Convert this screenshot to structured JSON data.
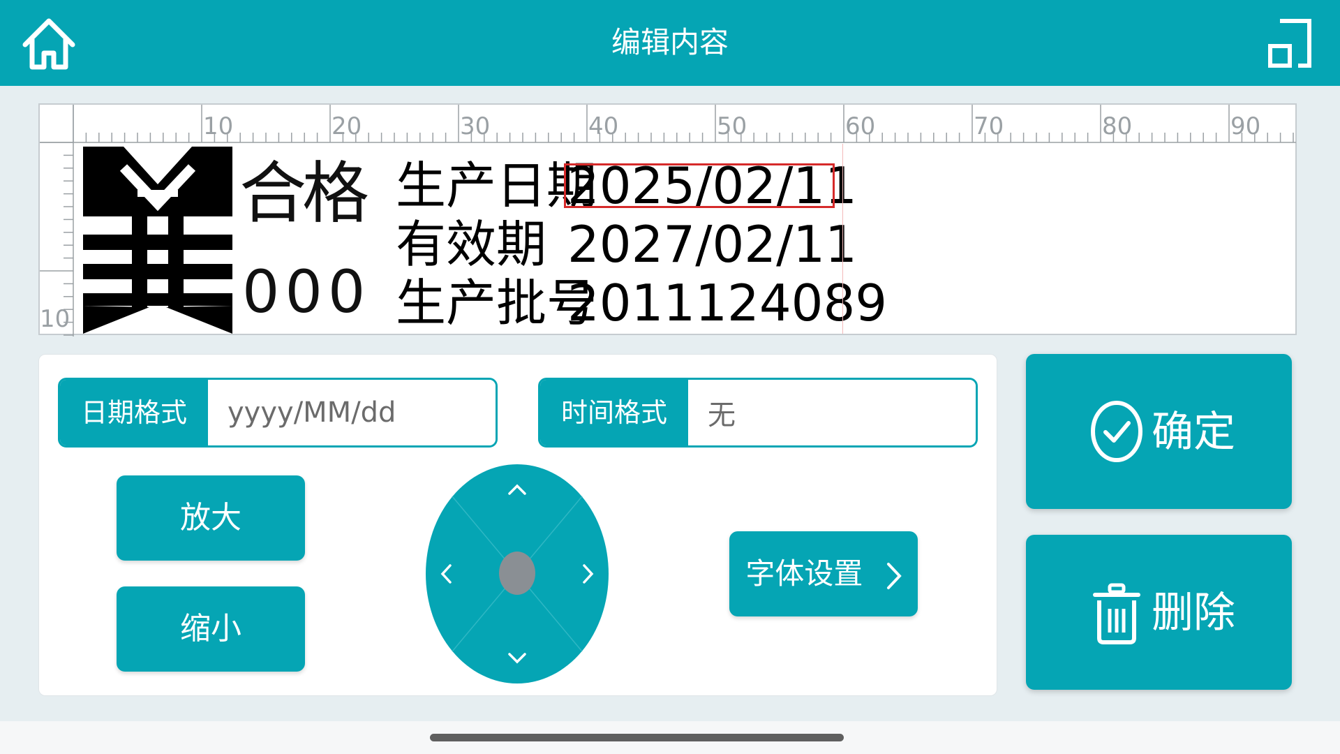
{
  "header": {
    "title": "编辑内容",
    "home_icon": "home-icon",
    "expand_icon": "expand-icon"
  },
  "preview": {
    "ruler_top_labels": [
      "10",
      "20",
      "30",
      "40",
      "50",
      "60",
      "70",
      "80",
      "90"
    ],
    "ruler_left_label": "10",
    "logo_icon": "logo-mark-icon",
    "stamp_text": "合格",
    "stamp_number": "000",
    "lines": [
      {
        "label": "生产日期",
        "value": "2025/02/11"
      },
      {
        "label": "有效期",
        "value": "2027/02/11"
      },
      {
        "label": "生产批号",
        "value": "2011124089"
      }
    ],
    "selection_color": "#d62a2a"
  },
  "controls": {
    "date_format": {
      "label": "日期格式",
      "placeholder": "yyyy/MM/dd"
    },
    "time_format": {
      "label": "时间格式",
      "value": "无"
    },
    "zoom_in": "放大",
    "zoom_out": "缩小",
    "font_settings": "字体设置"
  },
  "actions": {
    "confirm": "确定",
    "delete": "删除"
  },
  "colors": {
    "accent": "#05a5b4",
    "background": "#e6eef1",
    "dpad_center": "#8a8f94"
  }
}
